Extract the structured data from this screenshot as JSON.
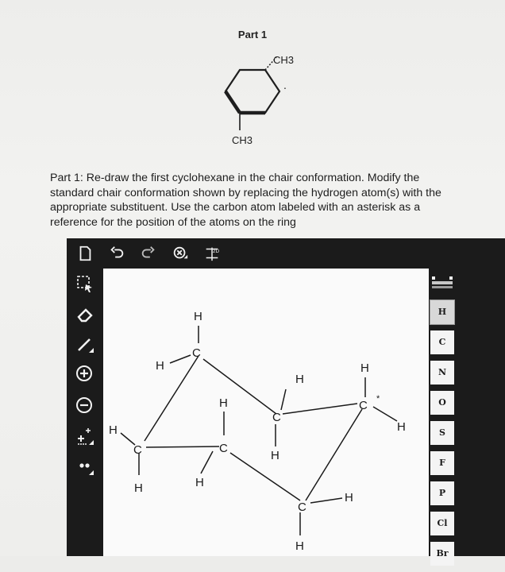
{
  "header": {
    "part_title": "Part 1"
  },
  "molecule": {
    "top_substituent": "CH3",
    "bottom_substituent": "CH3",
    "marker": "."
  },
  "question": {
    "text": "Part 1: Re-draw the first cyclohexane in the chair conformation. Modify the standard chair conformation shown by replacing the hydrogen atom(s) with the appropriate substituent. Use the carbon atom labeled with an asterisk as a reference for the position of the atoms on the ring"
  },
  "toolbar": {
    "items": [
      {
        "name": "new-document-icon"
      },
      {
        "name": "undo-icon"
      },
      {
        "name": "redo-icon"
      },
      {
        "name": "zoom-icon"
      },
      {
        "name": "2d-clean-icon",
        "label": "2D"
      }
    ]
  },
  "left_tools": [
    {
      "name": "select-tool-icon"
    },
    {
      "name": "eraser-tool-icon"
    },
    {
      "name": "bond-tool-icon"
    },
    {
      "name": "positive-charge-icon"
    },
    {
      "name": "negative-charge-icon"
    },
    {
      "name": "atom-charge-icon"
    },
    {
      "name": "lone-pair-icon"
    }
  ],
  "elements": [
    "H",
    "C",
    "N",
    "O",
    "S",
    "F",
    "P",
    "Cl",
    "Br"
  ],
  "chair": {
    "labels": {
      "h_top": "H",
      "h_c1_left": "H",
      "c1": "C",
      "h_left": "H",
      "c_left": "C",
      "h_left_bottom": "H",
      "h_mid_top": "H",
      "c_mid": "C",
      "h_mid_bottom": "H",
      "h_center_top": "H",
      "c_center": "C",
      "h_center_bottom": "H",
      "h_right_top": "H",
      "c_right": "C",
      "asterisk": "*",
      "h_right": "H",
      "c_bottom": "C",
      "h_bottom_right": "H",
      "h_bottom": "H"
    }
  },
  "colors": {
    "toolbar": "#1b1b1b",
    "canvas": "#fafafa",
    "text": "#1e1e1e"
  }
}
